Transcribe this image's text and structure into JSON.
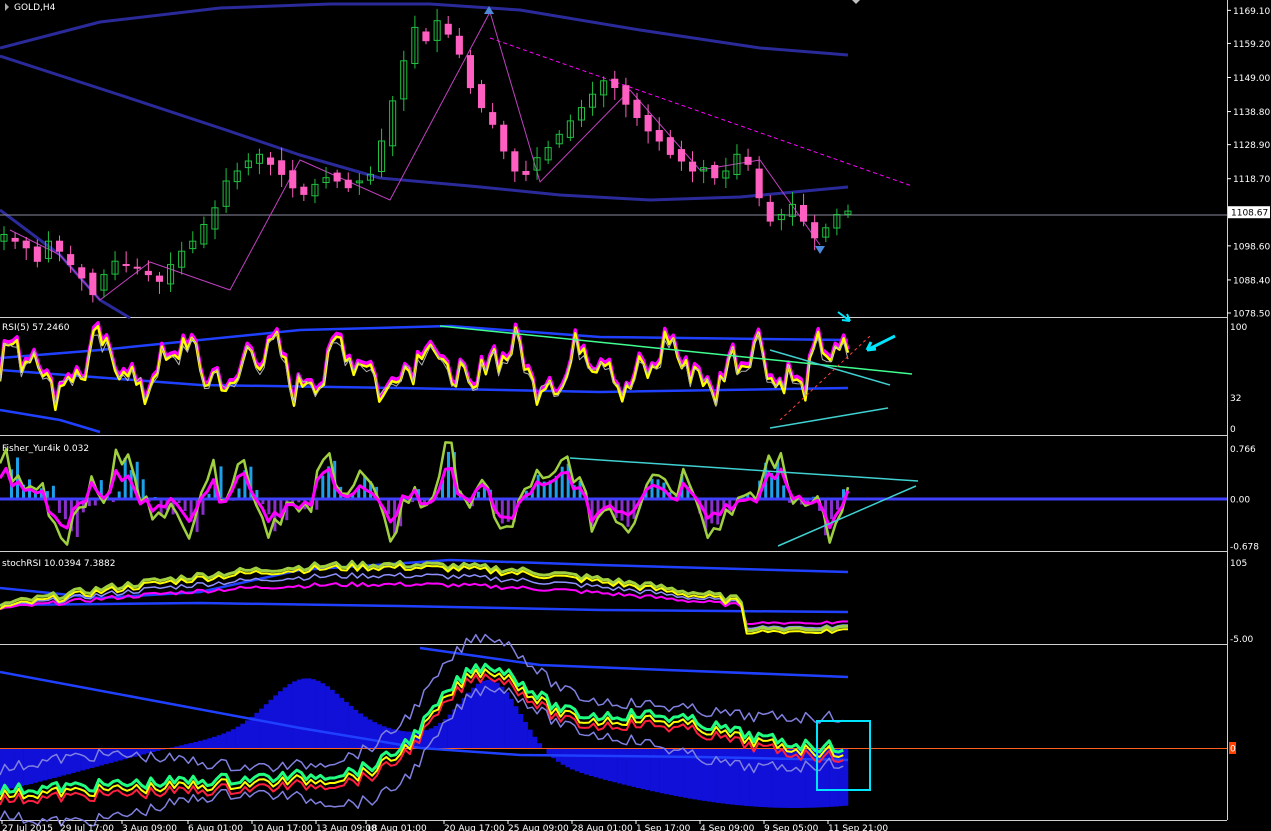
{
  "chart_data": [
    {
      "type": "candlestick",
      "title": "GOLD,H4",
      "y_ticks": [
        "1169.10",
        "1159.20",
        "1149.00",
        "1138.80",
        "1128.90",
        "1118.70",
        "1108.67",
        "1098.60",
        "1088.40",
        "1078.50"
      ],
      "ylim": [
        1078.5,
        1171
      ],
      "current_price": "1108.67",
      "close_approx": [
        1102,
        1100,
        1098,
        1094,
        1100,
        1097,
        1093,
        1089,
        1084,
        1090,
        1094,
        1093,
        1092,
        1090,
        1088,
        1093,
        1097,
        1100,
        1105,
        1110,
        1118,
        1121,
        1124,
        1126,
        1123,
        1120,
        1116,
        1114,
        1117,
        1119,
        1118,
        1116,
        1118,
        1120,
        1130,
        1142,
        1154,
        1164,
        1160,
        1166,
        1162,
        1156,
        1146,
        1140,
        1135,
        1127,
        1121,
        1120,
        1125,
        1128,
        1132,
        1136,
        1140,
        1144,
        1148,
        1146,
        1141,
        1137,
        1133,
        1130,
        1126,
        1124,
        1121,
        1122,
        1119,
        1121,
        1126,
        1123,
        1113,
        1106,
        1108,
        1111,
        1106,
        1101,
        1104,
        1108,
        1109
      ]
    },
    {
      "type": "line",
      "title": "RSI(5) 57.2460",
      "y_ticks": [
        "100",
        "32",
        "0"
      ],
      "ylim": [
        0,
        100
      ]
    },
    {
      "type": "histogram",
      "title": "Fisher_Yur4ik 0.032",
      "y_ticks": [
        "0.766",
        "0.00",
        "-0.678"
      ],
      "ylim": [
        -0.678,
        0.766
      ]
    },
    {
      "type": "line",
      "title": "stochRSI 10.0394 7.3882",
      "y_ticks": [
        "105",
        "-5.00"
      ],
      "ylim": [
        -5,
        105
      ]
    },
    {
      "type": "histogram",
      "title": "",
      "y_ticks": [],
      "zero_marker": "0"
    }
  ],
  "x_ticks": [
    "27 Jul 2015",
    "29 Jul 17:00",
    "3 Aug 09:00",
    "6 Aug 01:00",
    "10 Aug 17:00",
    "13 Aug 09:00",
    "18 Aug 01:00",
    "20 Aug 17:00",
    "25 Aug 09:00",
    "28 Aug 01:00",
    "1 Sep 17:00",
    "4 Sep 09:00",
    "9 Sep 05:00",
    "11 Sep 21:00"
  ],
  "colors": {
    "background": "#000000",
    "bull": "#20c040",
    "bear": "#ff5fc0",
    "band": "#2a2a9a",
    "rsi": "#ffff00",
    "magenta": "#ff00ff",
    "cyan": "#00e0ff",
    "trend_green": "#40ff90",
    "axis": "#ffffff"
  }
}
